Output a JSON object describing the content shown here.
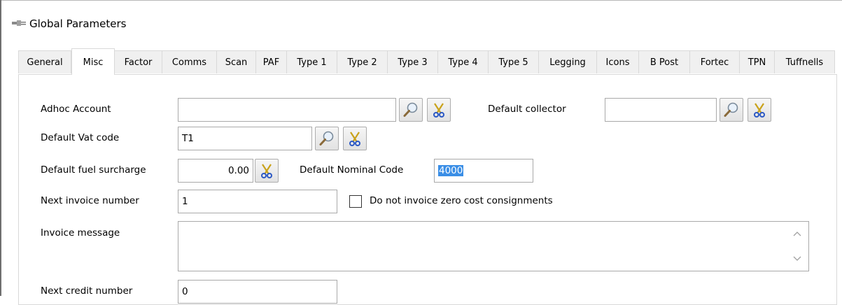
{
  "window": {
    "title": "Global Parameters"
  },
  "tabs": [
    {
      "label": "General"
    },
    {
      "label": "Misc"
    },
    {
      "label": "Factor"
    },
    {
      "label": "Comms"
    },
    {
      "label": "Scan"
    },
    {
      "label": "PAF"
    },
    {
      "label": "Type 1"
    },
    {
      "label": "Type 2"
    },
    {
      "label": "Type 3"
    },
    {
      "label": "Type 4"
    },
    {
      "label": "Type 5"
    },
    {
      "label": "Legging"
    },
    {
      "label": "Icons"
    },
    {
      "label": "B Post"
    },
    {
      "label": "Fortec"
    },
    {
      "label": "TPN"
    },
    {
      "label": "Tuffnells"
    }
  ],
  "active_tab": "Misc",
  "form": {
    "adhoc_account": {
      "label": "Adhoc Account",
      "value": ""
    },
    "default_collector": {
      "label": "Default collector",
      "value": ""
    },
    "default_vat_code": {
      "label": "Default Vat code",
      "value": "T1"
    },
    "default_fuel_surcharge": {
      "label": "Default fuel surcharge",
      "value": "0.00"
    },
    "default_nominal_code": {
      "label": "Default Nominal Code",
      "value": "4000"
    },
    "next_invoice_number": {
      "label": "Next invoice number",
      "value": "1"
    },
    "no_invoice_zero_cost": {
      "label": "Do not invoice zero cost consignments",
      "checked": false
    },
    "invoice_message": {
      "label": "Invoice message",
      "value": ""
    },
    "next_credit_number": {
      "label": "Next credit number",
      "value": "0"
    }
  },
  "icons": {
    "lookup": "magnifier-icon",
    "clear": "scissors-icon",
    "window": "connector-icon"
  },
  "colors": {
    "selection": "#3a8ee6",
    "tab_inactive": "#f0f0f0",
    "border": "#a9a9a9"
  }
}
